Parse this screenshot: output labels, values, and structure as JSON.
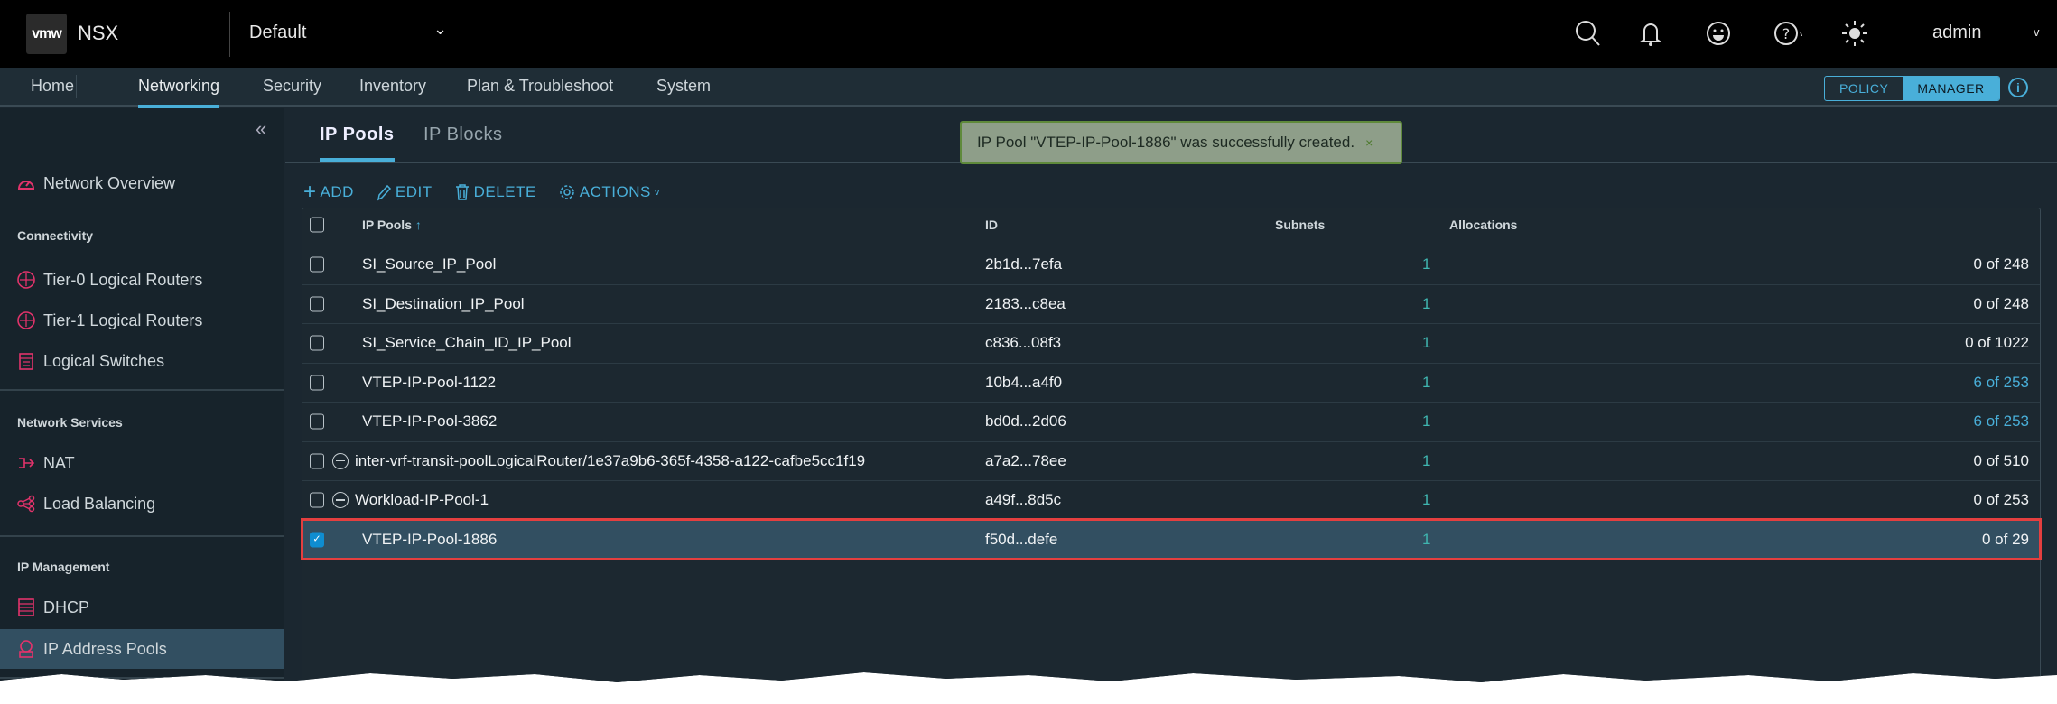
{
  "header": {
    "logo": "vmw",
    "product": "NSX",
    "context": "Default",
    "user": "admin",
    "icons": [
      "search-icon",
      "bell-icon",
      "smiley-icon",
      "help-icon",
      "sun-icon"
    ]
  },
  "nav": {
    "items": [
      "Home",
      "Networking",
      "Security",
      "Inventory",
      "Plan & Troubleshoot",
      "System"
    ],
    "active": "Networking",
    "mode": {
      "policy": "POLICY",
      "manager": "MANAGER",
      "active": "MANAGER"
    }
  },
  "sidebar": {
    "overview": "Network Overview",
    "sections": [
      {
        "title": "Connectivity",
        "items": [
          "Tier-0 Logical Routers",
          "Tier-1 Logical Routers",
          "Logical Switches"
        ]
      },
      {
        "title": "Network Services",
        "items": [
          "NAT",
          "Load Balancing"
        ]
      },
      {
        "title": "IP Management",
        "items": [
          "DHCP",
          "IP Address Pools"
        ]
      }
    ],
    "selected": "IP Address Pools"
  },
  "tabs": [
    "IP Pools",
    "IP Blocks"
  ],
  "toast": {
    "message": "IP Pool \"VTEP-IP-Pool-1886\" was successfully created.",
    "close": "×"
  },
  "toolbar": {
    "add": "ADD",
    "edit": "EDIT",
    "delete": "DELETE",
    "actions": "ACTIONS"
  },
  "table": {
    "columns": [
      "IP Pools",
      "ID",
      "Subnets",
      "Allocations"
    ],
    "sort_indicator": "↑",
    "rows": [
      {
        "name": "SI_Source_IP_Pool",
        "id": "2b1d...7efa",
        "subnets": "1",
        "alloc": "0 of 248"
      },
      {
        "name": "SI_Destination_IP_Pool",
        "id": "2183...c8ea",
        "subnets": "1",
        "alloc": "0 of 248"
      },
      {
        "name": "SI_Service_Chain_ID_IP_Pool",
        "id": "c836...08f3",
        "subnets": "1",
        "alloc": "0 of 1022"
      },
      {
        "name": "VTEP-IP-Pool-1122",
        "id": "10b4...a4f0",
        "subnets": "1",
        "alloc": "6 of 253"
      },
      {
        "name": "VTEP-IP-Pool-3862",
        "id": "bd0d...2d06",
        "subnets": "1",
        "alloc": "6 of 253"
      },
      {
        "name": "inter-vrf-transit-poolLogicalRouter/1e37a9b6-365f-4358-a122-cafbe5cc1f19",
        "id": "a7a2...78ee",
        "subnets": "1",
        "alloc": "0 of 510"
      },
      {
        "name": "Workload-IP-Pool-1",
        "id": "a49f...8d5c",
        "subnets": "1",
        "alloc": "0 of 253"
      },
      {
        "name": "VTEP-IP-Pool-1886",
        "id": "f50d...defe",
        "subnets": "1",
        "alloc": "0 of 29"
      }
    ]
  },
  "colors": {
    "accent": "#49afd9",
    "selected_row": "#324f61",
    "highlight_outline": "#e43f3f",
    "icon_pink": "#e2336b",
    "toast_bg": "#8e9e89"
  }
}
